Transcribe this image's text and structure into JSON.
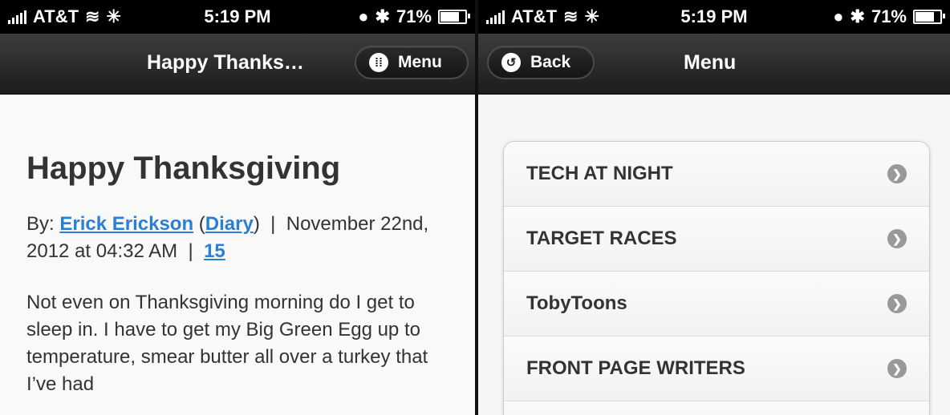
{
  "left": {
    "status": {
      "carrier": "AT&T",
      "time": "5:19 PM",
      "battery": "71%",
      "battery_level": 0.71
    },
    "nav": {
      "title": "Happy Thanks…",
      "menu_label": "Menu"
    },
    "article": {
      "title": "Happy Thanksgiving",
      "by_prefix": "By:",
      "author": "Erick Erickson",
      "diary": "Diary",
      "date": "November 22nd, 2012 at 04:32 AM",
      "separator": "|",
      "comments": "15",
      "body": "Not even on Thanksgiving morning do I get to sleep in. I have to get my Big Green Egg up to temperature, smear butter all over a turkey that I’ve had"
    }
  },
  "right": {
    "status": {
      "carrier": "AT&T",
      "time": "5:19 PM",
      "battery": "71%",
      "battery_level": 0.71
    },
    "nav": {
      "back_label": "Back",
      "title": "Menu"
    },
    "menu_items": [
      {
        "label": "TECH AT NIGHT"
      },
      {
        "label": "TARGET RACES"
      },
      {
        "label": "TobyToons"
      },
      {
        "label": "FRONT PAGE WRITERS"
      }
    ]
  }
}
